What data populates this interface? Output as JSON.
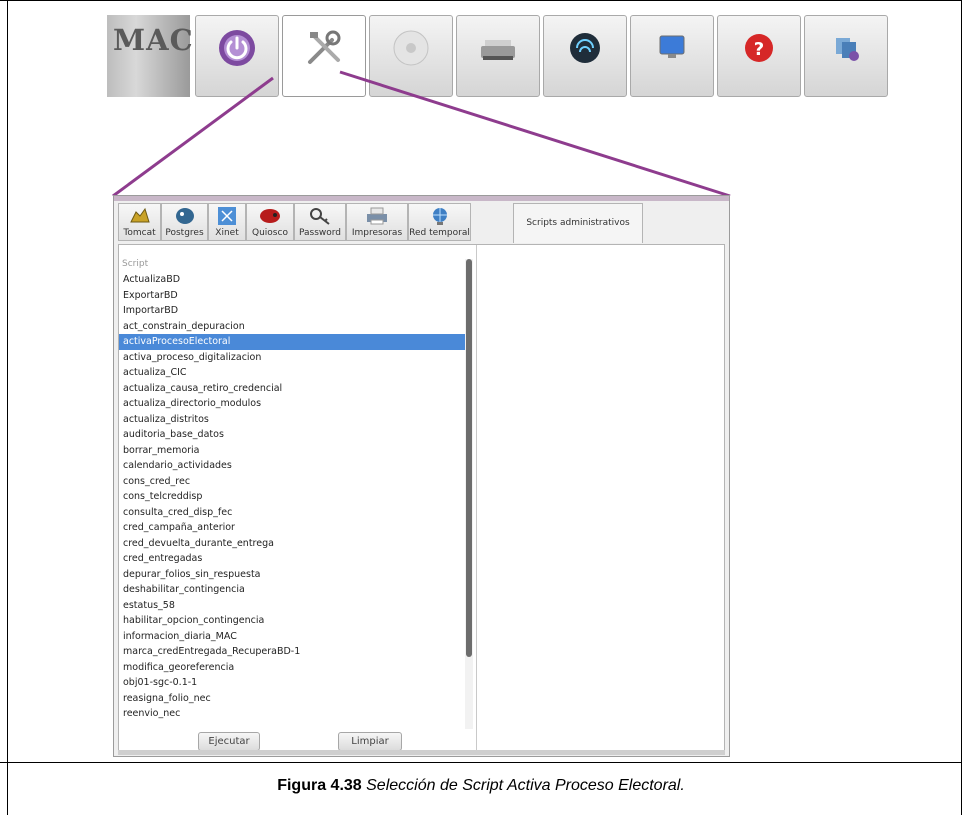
{
  "toolbar": {
    "logo_text": "MAC",
    "buttons": [
      {
        "icon": "power-icon"
      },
      {
        "icon": "tools-icon"
      },
      {
        "icon": "disc-icon"
      },
      {
        "icon": "scanner-icon"
      },
      {
        "icon": "fingerprint-icon"
      },
      {
        "icon": "monitor-icon"
      },
      {
        "icon": "help-icon"
      },
      {
        "icon": "server-icon"
      }
    ],
    "selected_button": "tools-icon"
  },
  "dialog": {
    "tabs": [
      {
        "label": "Tomcat",
        "icon": "tomcat-icon"
      },
      {
        "label": "Postgres",
        "icon": "postgres-icon"
      },
      {
        "label": "Xinet",
        "icon": "xinet-icon"
      },
      {
        "label": "Quiosco",
        "icon": "quiosco-icon"
      },
      {
        "label": "Password",
        "icon": "key-icon"
      },
      {
        "label": "Impresoras",
        "icon": "printer-icon"
      },
      {
        "label": "Red temporal",
        "icon": "network-icon"
      },
      {
        "label": "Scripts administrativos",
        "icon": ""
      }
    ],
    "active_tab": "Scripts administrativos",
    "list_header": "Script",
    "scripts": [
      "ActualizaBD",
      "ExportarBD",
      "ImportarBD",
      "act_constrain_depuracion",
      "activaProcesoElectoral",
      "activa_proceso_digitalizacion",
      "actualiza_CIC",
      "actualiza_causa_retiro_credencial",
      "actualiza_directorio_modulos",
      "actualiza_distritos",
      "auditoria_base_datos",
      "borrar_memoria",
      "calendario_actividades",
      "cons_cred_rec",
      "cons_telcreddisp",
      "consulta_cred_disp_fec",
      "cred_campaña_anterior",
      "cred_devuelta_durante_entrega",
      "cred_entregadas",
      "depurar_folios_sin_respuesta",
      "deshabilitar_contingencia",
      "estatus_58",
      "habilitar_opcion_contingencia",
      "informacion_diaria_MAC",
      "marca_credEntregada_RecuperaBD-1",
      "modifica_georeferencia",
      "obj01-sgc-0.1-1",
      "reasigna_folio_nec",
      "reenvio_nec"
    ],
    "selected_script": "activaProcesoElectoral",
    "execute_label": "Ejecutar",
    "clear_label": "Limpiar"
  },
  "caption": {
    "number": "Figura 4.38",
    "text": " Selección de Script Activa Proceso Electoral."
  },
  "colors": {
    "pointer_line": "#8e3c8e",
    "selection": "#4a89d8"
  }
}
